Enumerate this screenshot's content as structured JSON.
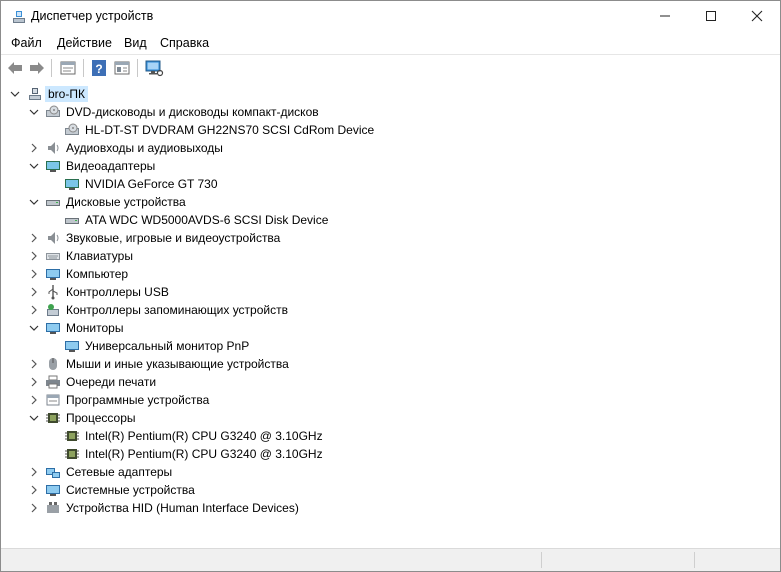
{
  "window": {
    "title": "Диспетчер устройств"
  },
  "menu": [
    "Файл",
    "Действие",
    "Вид",
    "Справка"
  ],
  "toolbar": {
    "icons": [
      "back-arrow-icon",
      "forward-arrow-icon",
      "properties-icon",
      "help-icon",
      "details-icon",
      "monitor-scan-icon"
    ]
  },
  "tree": {
    "root": "bro-ПК",
    "categories": [
      {
        "label": "DVD-дисководы и дисководы компакт-дисков",
        "expanded": true,
        "icon": "dvd-drive-icon",
        "children": [
          "HL-DT-ST DVDRAM GH22NS70 SCSI CdRom Device"
        ]
      },
      {
        "label": "Аудиовходы и аудиовыходы",
        "expanded": false,
        "icon": "speaker-icon",
        "children": []
      },
      {
        "label": "Видеоадаптеры",
        "expanded": true,
        "icon": "display-adapter-icon",
        "children": [
          "NVIDIA GeForce GT 730"
        ]
      },
      {
        "label": "Дисковые устройства",
        "expanded": true,
        "icon": "disk-drive-icon",
        "children": [
          "ATA WDC WD5000AVDS-6 SCSI Disk Device"
        ]
      },
      {
        "label": "Звуковые, игровые и видеоустройства",
        "expanded": false,
        "icon": "speaker-icon",
        "children": []
      },
      {
        "label": "Клавиатуры",
        "expanded": false,
        "icon": "keyboard-icon",
        "children": []
      },
      {
        "label": "Компьютер",
        "expanded": false,
        "icon": "computer-icon",
        "children": []
      },
      {
        "label": "Контроллеры USB",
        "expanded": false,
        "icon": "usb-icon",
        "children": []
      },
      {
        "label": "Контроллеры запоминающих устройств",
        "expanded": false,
        "icon": "storage-controller-icon",
        "children": []
      },
      {
        "label": "Мониторы",
        "expanded": true,
        "icon": "monitor-icon",
        "children": [
          "Универсальный монитор PnP"
        ]
      },
      {
        "label": "Мыши и иные указывающие устройства",
        "expanded": false,
        "icon": "mouse-icon",
        "children": []
      },
      {
        "label": "Очереди печати",
        "expanded": false,
        "icon": "printer-icon",
        "children": []
      },
      {
        "label": "Программные устройства",
        "expanded": false,
        "icon": "software-device-icon",
        "children": []
      },
      {
        "label": "Процессоры",
        "expanded": true,
        "icon": "cpu-icon",
        "children": [
          "Intel(R) Pentium(R) CPU G3240 @ 3.10GHz",
          "Intel(R) Pentium(R) CPU G3240 @ 3.10GHz"
        ]
      },
      {
        "label": "Сетевые адаптеры",
        "expanded": false,
        "icon": "network-adapter-icon",
        "children": []
      },
      {
        "label": "Системные устройства",
        "expanded": false,
        "icon": "system-device-icon",
        "children": []
      },
      {
        "label": "Устройства HID (Human Interface Devices)",
        "expanded": false,
        "icon": "hid-icon",
        "children": []
      }
    ]
  }
}
